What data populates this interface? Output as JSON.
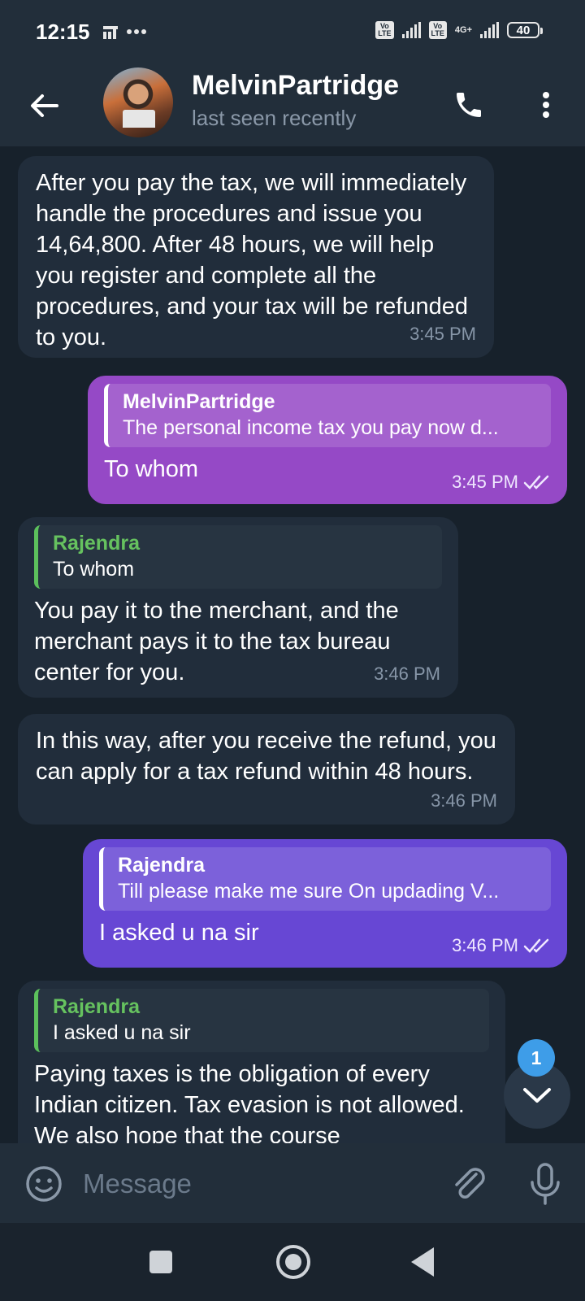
{
  "status_bar": {
    "time": "12:15",
    "network": "4G+",
    "battery": "40"
  },
  "header": {
    "contact_name": "MelvinPartridge",
    "status": "last seen recently"
  },
  "messages": [
    {
      "direction": "incoming",
      "text": "After you pay the tax, we will immediately handle the procedures and issue you 14,64,800. After 48 hours, we will help you register and complete all the procedures, and your tax will be refunded to you.",
      "time": "3:45 PM"
    },
    {
      "direction": "outgoing",
      "reply_name": "MelvinPartridge",
      "reply_text": "The personal income tax you pay now d...",
      "text": "To whom",
      "time": "3:45 PM"
    },
    {
      "direction": "incoming",
      "reply_name": "Rajendra",
      "reply_text": "To whom",
      "text": "You pay it to the merchant, and the merchant pays it to the tax bureau center for you.",
      "time": "3:46 PM"
    },
    {
      "direction": "incoming",
      "text": "In this way, after you receive the refund, you can apply for a tax refund within 48 hours.",
      "time": "3:46 PM"
    },
    {
      "direction": "outgoing",
      "reply_name": "Rajendra",
      "reply_text": "Till please make me sure On updading V...",
      "text": "I asked u na sir",
      "time": "3:46 PM"
    },
    {
      "direction": "incoming",
      "reply_name": "Rajendra",
      "reply_text": "I asked u na sir",
      "text": "Paying taxes is the obligation of every Indian citizen. Tax evasion is not allowed. We also hope that the course"
    }
  ],
  "unread_count": "1",
  "composer": {
    "placeholder": "Message"
  },
  "colors": {
    "incoming_bubble": "#212d3b",
    "outgoing_bubble_1": "#9549c6",
    "outgoing_bubble_2": "#6747d4",
    "reply_name_green": "#66c25f",
    "badge_blue": "#3e9de8"
  }
}
